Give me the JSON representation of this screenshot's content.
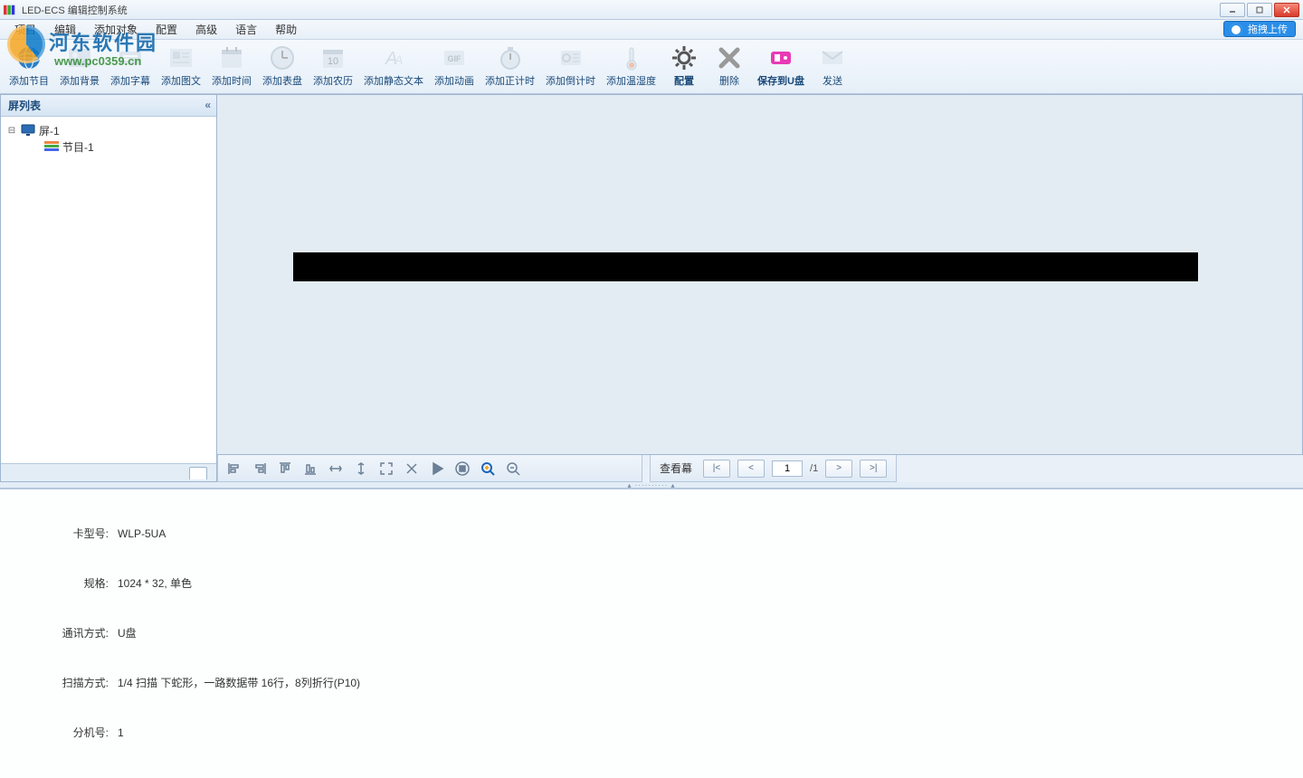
{
  "titlebar": {
    "title": "LED-ECS 编辑控制系统"
  },
  "watermark": {
    "name": "河东软件园",
    "url": "www.pc0359.cn"
  },
  "menu": [
    "项目",
    "编辑",
    "添加对象",
    "配置",
    "高级",
    "语言",
    "帮助"
  ],
  "drag_upload": "拖拽上传",
  "toolbar": [
    {
      "label": "添加节目",
      "icon": "globe",
      "c": "#2a7fc9"
    },
    {
      "label": "添加背景",
      "icon": "image"
    },
    {
      "label": "添加字幕",
      "icon": "subtitle"
    },
    {
      "label": "添加图文",
      "icon": "picture"
    },
    {
      "label": "添加时间",
      "icon": "calendar"
    },
    {
      "label": "添加表盘",
      "icon": "clock"
    },
    {
      "label": "添加农历",
      "icon": "cal10"
    },
    {
      "label": "添加静态文本",
      "icon": "text"
    },
    {
      "label": "添加动画",
      "icon": "gif"
    },
    {
      "label": "添加正计时",
      "icon": "stopwatch"
    },
    {
      "label": "添加倒计时",
      "icon": "timer"
    },
    {
      "label": "添加温湿度",
      "icon": "thermo"
    },
    {
      "label": "配置",
      "icon": "gear",
      "c": "#555",
      "bold": true
    },
    {
      "label": "删除",
      "icon": "x",
      "c": "#888"
    },
    {
      "label": "保存到U盘",
      "icon": "usb",
      "c": "#e83ab5",
      "bold": true
    },
    {
      "label": "发送",
      "icon": "mail"
    }
  ],
  "sidebar": {
    "header": "屏列表",
    "nodes": [
      {
        "label": "屏-1",
        "icon": "monitor",
        "expanded": true,
        "children": [
          {
            "label": "节目-1",
            "icon": "program"
          }
        ]
      }
    ]
  },
  "paging": {
    "label": "查看幕",
    "first": "|<",
    "prev": "<",
    "value": "1",
    "sep": "/1",
    "next": ">",
    "last": ">|"
  },
  "info": [
    {
      "label": "卡型号:",
      "value": "WLP-5UA"
    },
    {
      "label": "规格:",
      "value": "1024 * 32, 单色"
    },
    {
      "label": "通讯方式:",
      "value": "U盘"
    },
    {
      "label": "扫描方式:",
      "value": "1/4 扫描 下蛇形，一路数据带 16行，8列折行(P10)"
    },
    {
      "label": "分机号:",
      "value": "1"
    }
  ]
}
